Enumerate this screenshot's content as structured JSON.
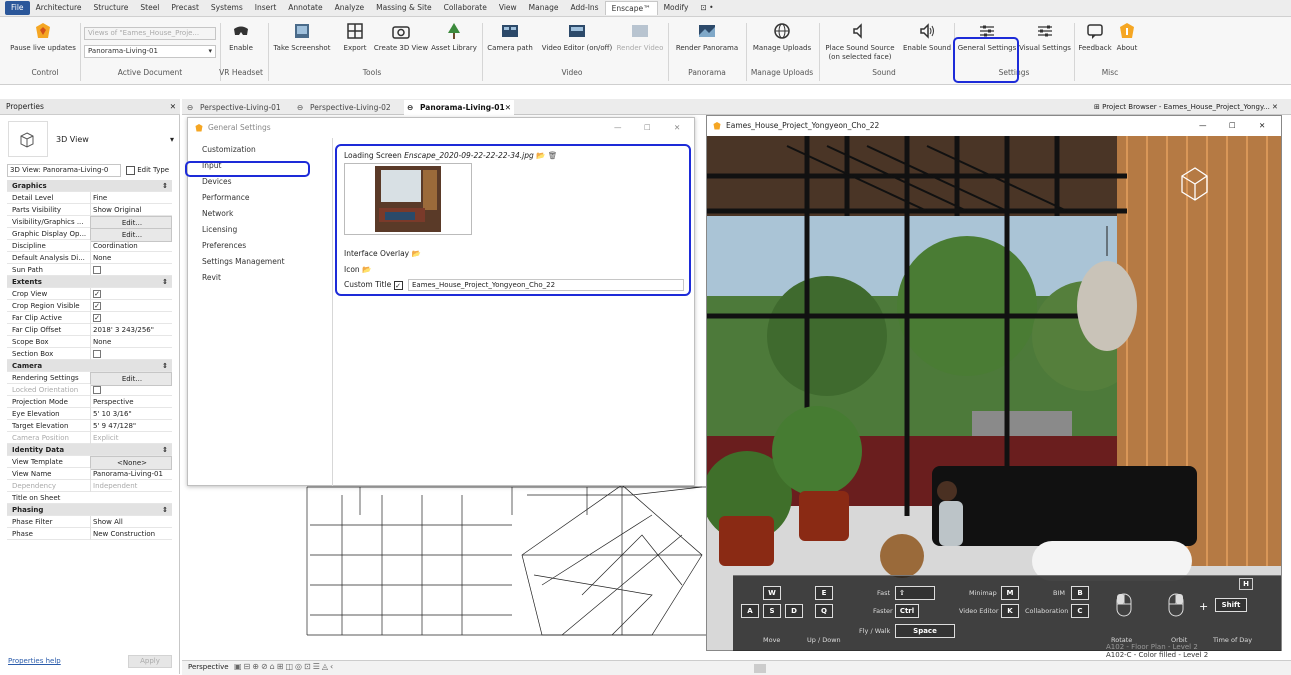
{
  "ribbon_tabs": [
    "File",
    "Architecture",
    "Structure",
    "Steel",
    "Precast",
    "Systems",
    "Insert",
    "Annotate",
    "Analyze",
    "Massing & Site",
    "Collaborate",
    "View",
    "Manage",
    "Add-Ins",
    "Enscape™",
    "Modify",
    "⊡ •"
  ],
  "ribbon": {
    "pause_live_updates": "Pause live updates",
    "views_placeholder": "Views of \"Eames_House_Proje...",
    "active_document_value": "Panorama-Living-01",
    "enable": "Enable",
    "take_screenshot": "Take Screenshot",
    "export": "Export",
    "create_3d_view": "Create 3D View",
    "asset_library": "Asset Library",
    "camera_path": "Camera path",
    "video_editor": "Video Editor (on/off)",
    "render_video": "Render Video",
    "render_panorama": "Render Panorama",
    "manage_uploads": "Manage Uploads",
    "place_sound_source_1": "Place Sound Source",
    "place_sound_source_2": "(on selected face)",
    "enable_sound": "Enable Sound",
    "general_settings": "General Settings",
    "visual_settings": "Visual Settings",
    "feedback": "Feedback",
    "about": "About",
    "groups": {
      "control": "Control",
      "active_document": "Active Document",
      "vr_headset": "VR Headset",
      "tools": "Tools",
      "video": "Video",
      "panorama": "Panorama",
      "manage_uploads": "Manage Uploads",
      "sound": "Sound",
      "settings": "Settings",
      "misc": "Misc"
    }
  },
  "properties": {
    "title": "Properties",
    "type_name": "3D View",
    "instance_selector": "3D View: Panorama-Living-0",
    "edit_type": "Edit Type",
    "rows": [
      {
        "k": "Graphics",
        "sec": true
      },
      {
        "k": "Detail Level",
        "v": "Fine"
      },
      {
        "k": "Parts Visibility",
        "v": "Show Original"
      },
      {
        "k": "Visibility/Graphics ...",
        "v": "Edit...",
        "btn": true
      },
      {
        "k": "Graphic Display Op...",
        "v": "Edit...",
        "btn": true
      },
      {
        "k": "Discipline",
        "v": "Coordination"
      },
      {
        "k": "Default Analysis Di...",
        "v": "None"
      },
      {
        "k": "Sun Path",
        "cb": false
      },
      {
        "k": "Extents",
        "sec": true
      },
      {
        "k": "Crop View",
        "cb": true
      },
      {
        "k": "Crop Region Visible",
        "cb": true
      },
      {
        "k": "Far Clip Active",
        "cb": true
      },
      {
        "k": "Far Clip Offset",
        "v": "2018' 3 243/256\""
      },
      {
        "k": "Scope Box",
        "v": "None"
      },
      {
        "k": "Section Box",
        "cb": false
      },
      {
        "k": "Camera",
        "sec": true
      },
      {
        "k": "Rendering Settings",
        "v": "Edit...",
        "btn": true
      },
      {
        "k": "Locked Orientation",
        "cb": false,
        "dim": true
      },
      {
        "k": "Projection Mode",
        "v": "Perspective"
      },
      {
        "k": "Eye Elevation",
        "v": "5'  10 3/16\""
      },
      {
        "k": "Target Elevation",
        "v": "5'  9 47/128\""
      },
      {
        "k": "Camera Position",
        "v": "Explicit",
        "dim": true
      },
      {
        "k": "Identity Data",
        "sec": true
      },
      {
        "k": "View Template",
        "v": "<None>",
        "btn": true
      },
      {
        "k": "View Name",
        "v": "Panorama-Living-01"
      },
      {
        "k": "Dependency",
        "v": "Independent",
        "dim": true
      },
      {
        "k": "Title on Sheet",
        "v": ""
      },
      {
        "k": "Phasing",
        "sec": true
      },
      {
        "k": "Phase Filter",
        "v": "Show All"
      },
      {
        "k": "Phase",
        "v": "New Construction"
      }
    ],
    "help_link": "Properties help",
    "apply": "Apply"
  },
  "view_tabs": [
    "Perspective-Living-01",
    "Perspective-Living-02",
    "Panorama-Living-01"
  ],
  "project_browser_title": "Project Browser - Eames_House_Project_Yongy...",
  "browser_items": [
    "A102 - Floor Plan - Level 2",
    "A102-C - Color filled - Level 2"
  ],
  "settings_dialog": {
    "title": "General Settings",
    "nav": [
      "Customization",
      "Input",
      "Devices",
      "Performance",
      "Network",
      "Licensing",
      "Preferences",
      "Settings Management",
      "Revit"
    ],
    "loading_screen_label": "Loading Screen",
    "loading_screen_file": "Enscape_2020-09-22-22-22-34.jpg",
    "interface_overlay": "Interface Overlay",
    "icon": "Icon",
    "custom_title": "Custom Title",
    "custom_title_value": "Eames_House_Project_Yongyeon_Cho_22"
  },
  "enscape_window": {
    "title": "Eames_House_Project_Yongyeon_Cho_22",
    "help_key": "H",
    "keys": {
      "w": "W",
      "a": "A",
      "s": "S",
      "d": "D",
      "e": "E",
      "q": "Q",
      "ctrl": "Ctrl",
      "space": "Space",
      "m": "M",
      "k": "K",
      "b": "B",
      "c": "C",
      "shift": "Shift"
    },
    "labels": {
      "fast": "Fast",
      "faster": "Faster",
      "fly_walk": "Fly / Walk",
      "minimap": "Minimap",
      "video_editor": "Video Editor",
      "bim": "BIM",
      "collaboration": "Collaboration",
      "move": "Move",
      "up_down": "Up / Down",
      "rotate": "Rotate",
      "orbit": "Orbit",
      "time_of_day": "Time of Day",
      "plus": "+"
    }
  },
  "status": {
    "view_mode": "Perspective"
  }
}
